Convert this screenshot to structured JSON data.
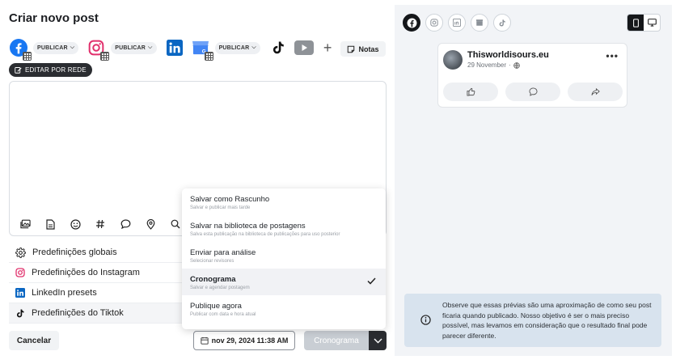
{
  "editor": {
    "title": "Criar novo post",
    "networks": [
      {
        "name": "facebook-icon",
        "color": "#1877f2",
        "publish_label": "PUBLICAR"
      },
      {
        "name": "instagram-icon",
        "color": "#e1306c",
        "publish_label": "PUBLICAR"
      },
      {
        "name": "linkedin-icon",
        "color": "#0a66c2"
      },
      {
        "name": "google-business-icon",
        "color": "#4285f4",
        "publish_label": "PUBLICAR"
      },
      {
        "name": "tiktok-icon",
        "color": "#111111"
      },
      {
        "name": "youtube-icon",
        "color": "#8e9297"
      }
    ],
    "notes_label": "Notas",
    "edit_per_network_label": "EDITAR POR REDE",
    "toolbar_icons": [
      "media-library-icon",
      "document-icon",
      "emoji-icon",
      "hashtag-icon",
      "comment-icon",
      "location-icon",
      "search-icon"
    ],
    "presets": [
      {
        "icon": "gear-icon",
        "label": "Predefinições globais"
      },
      {
        "icon": "instagram-icon",
        "label": "Predefinições do Instagram"
      },
      {
        "icon": "linkedin-icon",
        "label": "LinkedIn presets"
      },
      {
        "icon": "tiktok-icon",
        "label": "Predefinições do Tiktok"
      }
    ],
    "cancel_label": "Cancelar",
    "date_value": "nov 29, 2024 11:38 AM",
    "schedule_label": "Cronograma"
  },
  "dropdown": {
    "items": [
      {
        "label": "Salvar como Rascunho",
        "sub": "Salvar e publicar mais tarde",
        "selected": false
      },
      {
        "label": "Salvar na biblioteca de postagens",
        "sub": "Salva esta publicação na biblioteca de publicações para uso posterior",
        "selected": false
      },
      {
        "label": "Enviar para análise",
        "sub": "Selecionar revisores",
        "selected": false
      },
      {
        "label": "Cronograma",
        "sub": "Salvar e agendar postagem",
        "selected": true
      },
      {
        "label": "Publique agora",
        "sub": "Publicar com data e hora atual",
        "selected": false
      }
    ]
  },
  "preview": {
    "tabs": [
      "facebook-icon",
      "instagram-icon",
      "linkedin-icon",
      "google-business-icon",
      "tiktok-icon"
    ],
    "active_tab": "facebook-icon",
    "device": "mobile",
    "post": {
      "page_name": "Thisworldisours.eu",
      "date": "29 November",
      "separator": "·"
    },
    "notice": "Observe que essas prévias são uma aproximação de como seu post ficaria quando publicado. Nosso objetivo é ser o mais preciso possível, mas levamos em consideração que o resultado final pode parecer diferente."
  },
  "colors": {
    "dark": "#2b2d31",
    "notice_bg": "#d8e3ee",
    "disabled_button": "#c9ced4",
    "preview_bg": "#f2f4f7"
  }
}
